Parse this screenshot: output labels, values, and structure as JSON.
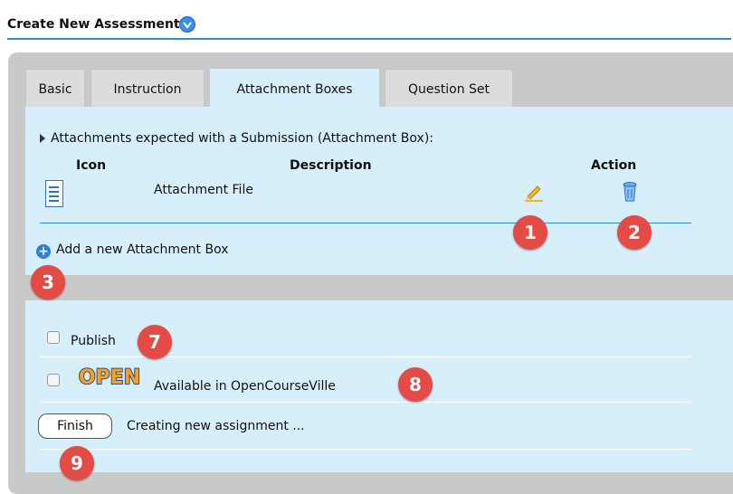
{
  "header": {
    "title": "Create New Assessment"
  },
  "tabs": [
    {
      "label": "Basic"
    },
    {
      "label": "Instruction"
    },
    {
      "label": "Attachment Boxes"
    },
    {
      "label": "Question Set"
    }
  ],
  "active_tab": "Attachment Boxes",
  "attachments": {
    "section_title": "Attachments expected with a Submission (Attachment Box):",
    "columns": [
      "Icon",
      "Description",
      "Action"
    ],
    "rows": [
      {
        "description": "Attachment File"
      }
    ],
    "add_label": "Add a new Attachment Box"
  },
  "options": {
    "publish_label": "Publish",
    "publish_checked": false,
    "opencourseville_label": "Available in OpenCourseVille",
    "opencourseville_checked": false,
    "logo_text": "OPEN"
  },
  "finish": {
    "button_label": "Finish",
    "status_text": "Creating new assignment ..."
  },
  "annotations": [
    "1",
    "2",
    "3",
    "7",
    "8",
    "9"
  ],
  "colors": {
    "accent": "#2d8fd8",
    "panel_gray": "#c9c9c9",
    "content_blue": "#d7eefb",
    "badge_red": "#e44b45"
  }
}
